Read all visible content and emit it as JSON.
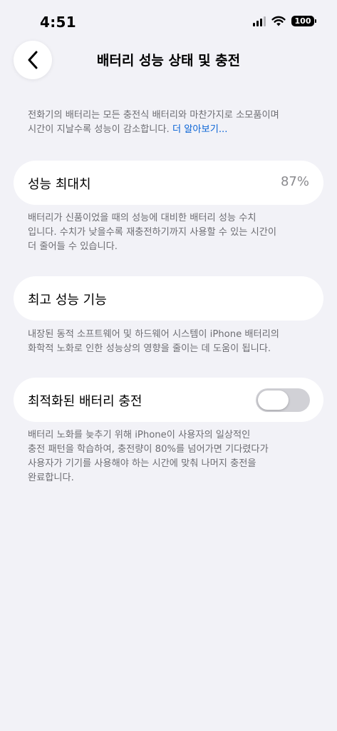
{
  "status_bar": {
    "time": "4:51",
    "battery_level": "100",
    "icons": [
      "cellular-signal-icon",
      "wifi-icon",
      "battery-icon"
    ]
  },
  "nav": {
    "back_icon": "chevron-left-icon",
    "title": "배터리 성능 상태 및 충전"
  },
  "intro": {
    "line1": "전화기의 배터리는 모든 충전식 배터리와 마찬가지로 소모품이며",
    "line2": "시간이 지날수록 성능이 감소합니다.",
    "link": "더 알아보기..."
  },
  "max_capacity": {
    "label": "성능 최대치",
    "value": "87%",
    "note_lines": [
      "배터리가 신품이었을 때의 성능에 대비한 배터리 성능 수치",
      "입니다. 수치가 낮을수록 재충전하기까지 사용할 수 있는 시간이",
      "더 줄어들 수 있습니다."
    ]
  },
  "peak_performance": {
    "label": "최고 성능 기능",
    "note_lines": [
      "내장된 동적 소프트웨어 및 하드웨어 시스템이 iPhone 배터리의",
      "화학적 노화로 인한 성능상의 영향을 줄이는 데 도움이 됩니다."
    ]
  },
  "optimized_charging": {
    "label": "최적화된 배터리 충전",
    "enabled": false,
    "note_lines": [
      "배터리 노화를 늦추기 위해 iPhone이 사용자의 일상적인",
      "충전 패턴을 학습하여, 충전량이 80%를 넘어가면 기다렸다가",
      "사용자가 기기를 사용해야 하는 시간에 맞춰 나머지 충전을",
      "완료합니다."
    ]
  },
  "colors": {
    "background": "#f2f2f7",
    "card": "#ffffff",
    "secondary_text": "#6d6d72",
    "link": "#0a64d6",
    "toggle_off": "#d1d1d6"
  }
}
